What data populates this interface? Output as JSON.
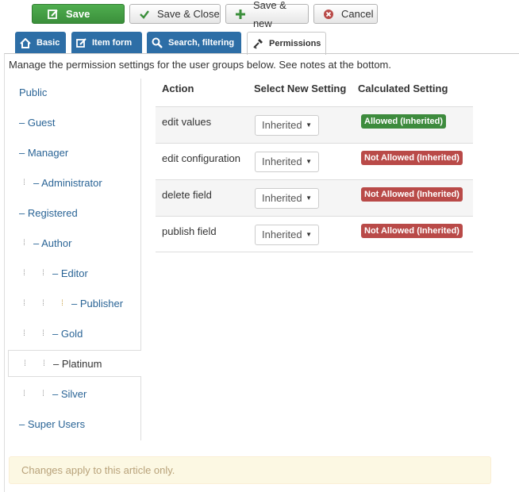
{
  "toolbar": {
    "save": "Save",
    "save_close": "Save & Close",
    "save_new": "Save & new",
    "cancel": "Cancel"
  },
  "tabs": [
    {
      "label": "Basic",
      "icon": "home-icon"
    },
    {
      "label": "Item form",
      "icon": "edit-icon"
    },
    {
      "label": "Search, filtering",
      "icon": "search-icon"
    },
    {
      "label": "Permissions",
      "icon": "key-icon",
      "active": true
    }
  ],
  "intro": "Manage the permission settings for the user groups below. See notes at the bottom.",
  "groups": [
    {
      "label": "Public"
    },
    {
      "label": "– Guest"
    },
    {
      "label": "– Manager"
    },
    {
      "label": "– Administrator"
    },
    {
      "label": "– Registered"
    },
    {
      "label": "– Author"
    },
    {
      "label": "– Editor"
    },
    {
      "label": "– Publisher"
    },
    {
      "label": "– Gold"
    },
    {
      "label": "– Platinum",
      "active": true
    },
    {
      "label": "– Silver"
    },
    {
      "label": "– Super Users"
    }
  ],
  "permissions": {
    "headers": {
      "action": "Action",
      "select": "Select New Setting",
      "calculated": "Calculated Setting"
    },
    "rows": [
      {
        "action": "edit values",
        "setting": "Inherited",
        "calculated": "Allowed (Inherited)",
        "status": "allowed"
      },
      {
        "action": "edit configuration",
        "setting": "Inherited",
        "calculated": "Not Allowed (Inherited)",
        "status": "denied"
      },
      {
        "action": "delete field",
        "setting": "Inherited",
        "calculated": "Not Allowed (Inherited)",
        "status": "denied"
      },
      {
        "action": "publish field",
        "setting": "Inherited",
        "calculated": "Not Allowed (Inherited)",
        "status": "denied"
      }
    ]
  },
  "notice": "Changes apply to this article only.",
  "colors": {
    "save_green": "#3b8f3b",
    "tab_blue": "#2d6ea6",
    "allowed_green": "#3d8b3d",
    "denied_red": "#b94a48",
    "link_blue": "#2a6496"
  }
}
